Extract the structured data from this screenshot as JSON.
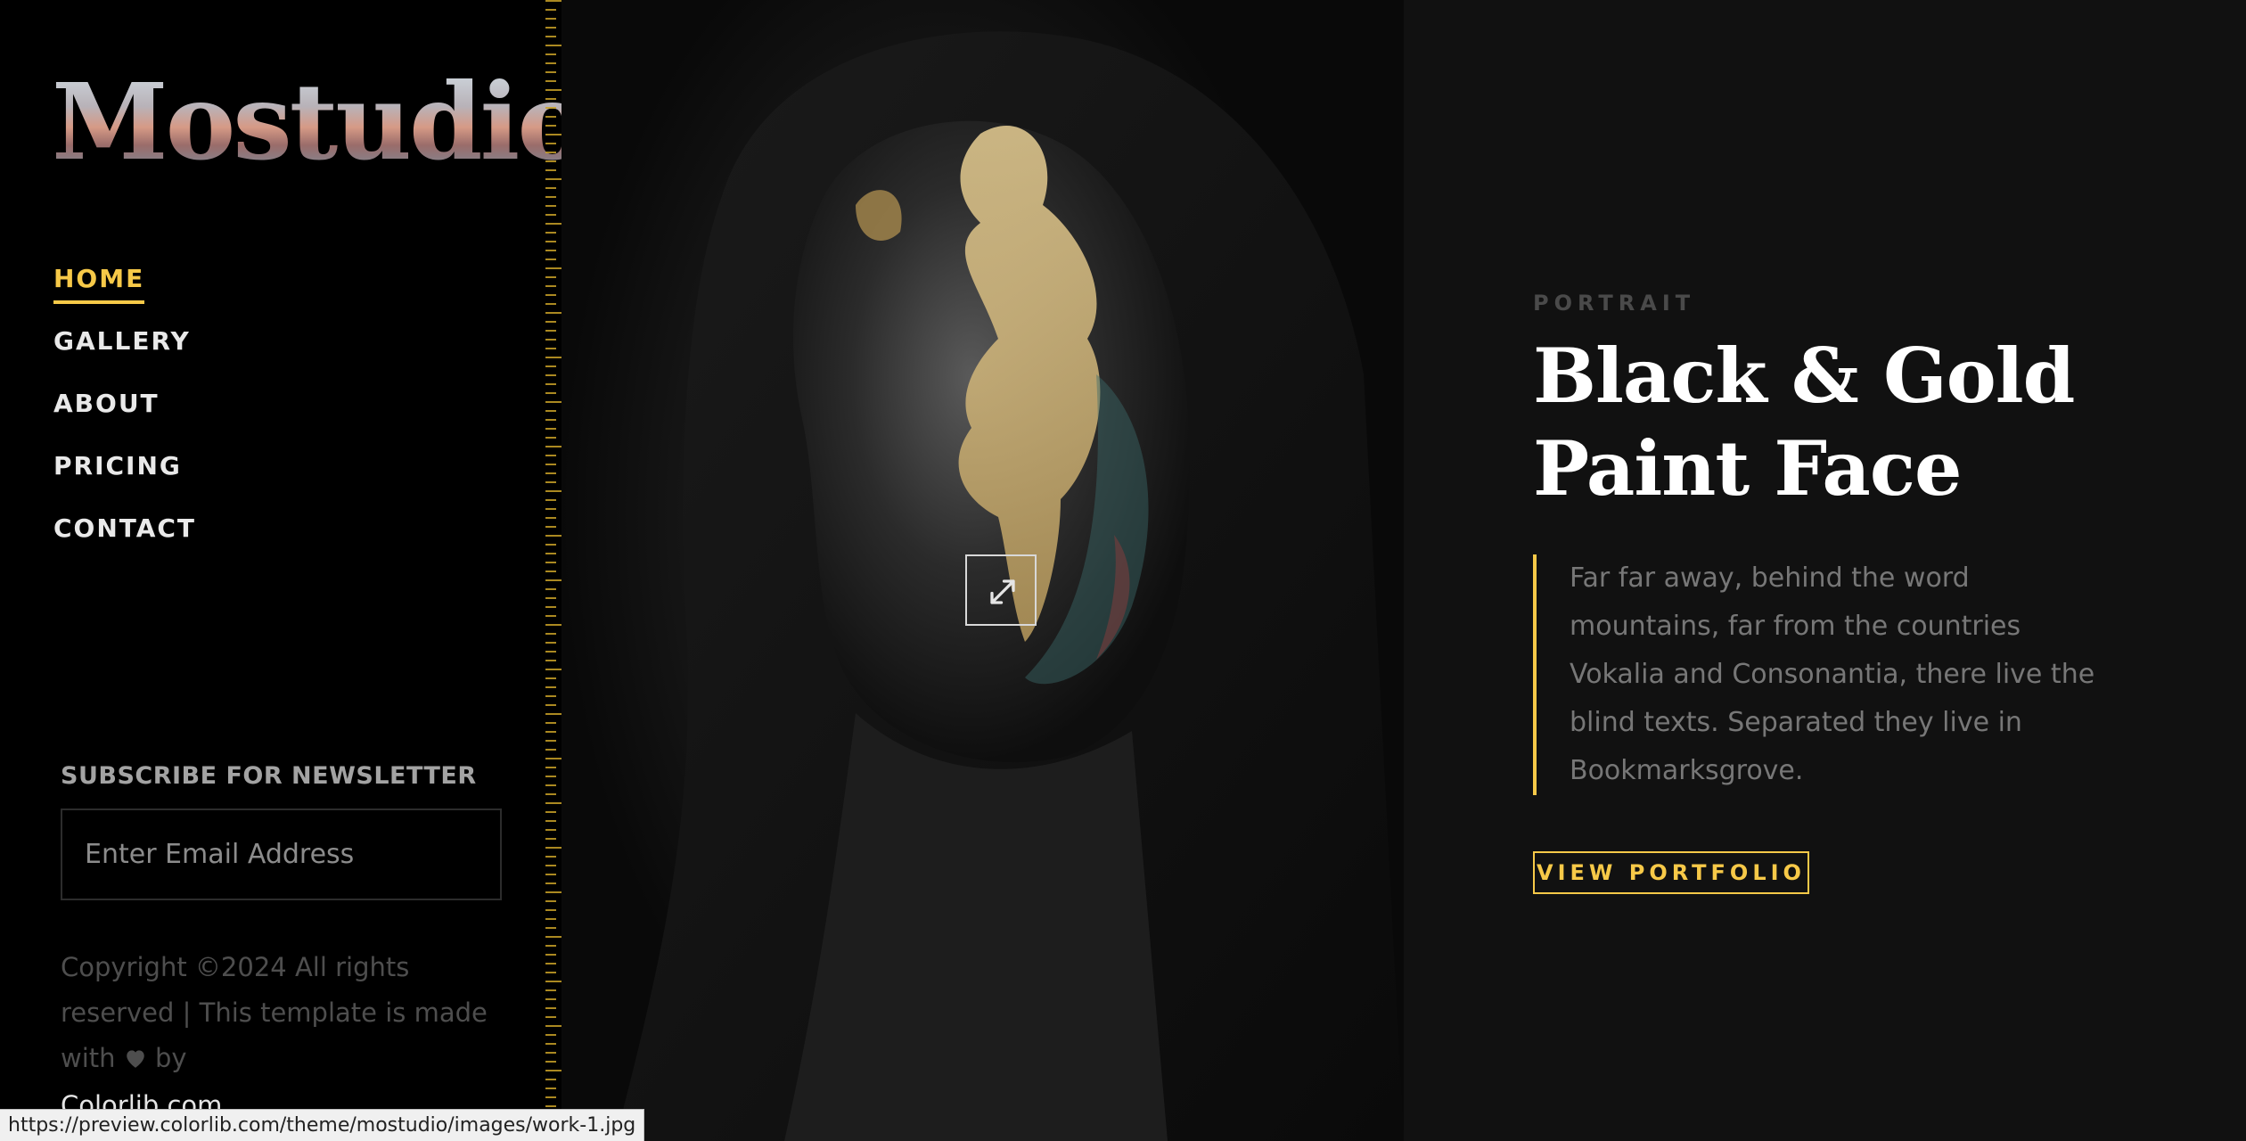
{
  "brand": {
    "logo_text": "Mostudio"
  },
  "nav": {
    "items": [
      {
        "label": "HOME",
        "active": true
      },
      {
        "label": "GALLERY",
        "active": false
      },
      {
        "label": "ABOUT",
        "active": false
      },
      {
        "label": "PRICING",
        "active": false
      },
      {
        "label": "CONTACT",
        "active": false
      }
    ]
  },
  "newsletter": {
    "title": "SUBSCRIBE FOR NEWSLETTER",
    "placeholder": "Enter Email Address"
  },
  "footer": {
    "copyright_prefix": "Copyright ©2024 All rights reserved | This template is made with",
    "copyright_by": "by",
    "link": "Colorlib.com"
  },
  "work": {
    "category": "PORTRAIT",
    "title_line1": "Black & Gold",
    "title_line2": "Paint Face",
    "description": "Far far away, behind the word mountains, far from the countries Vokalia and Consonantia, there live the blind texts. Separated they live in Bookmarksgrove.",
    "button_label": "VIEW PORTFOLIO",
    "expand_icon": "expand-icon"
  },
  "status_bar": {
    "url": "https://preview.colorlib.com/theme/mostudio/images/work-1.jpg"
  },
  "colors": {
    "accent": "#f7c948",
    "background": "#000000",
    "panel": "#111111"
  }
}
